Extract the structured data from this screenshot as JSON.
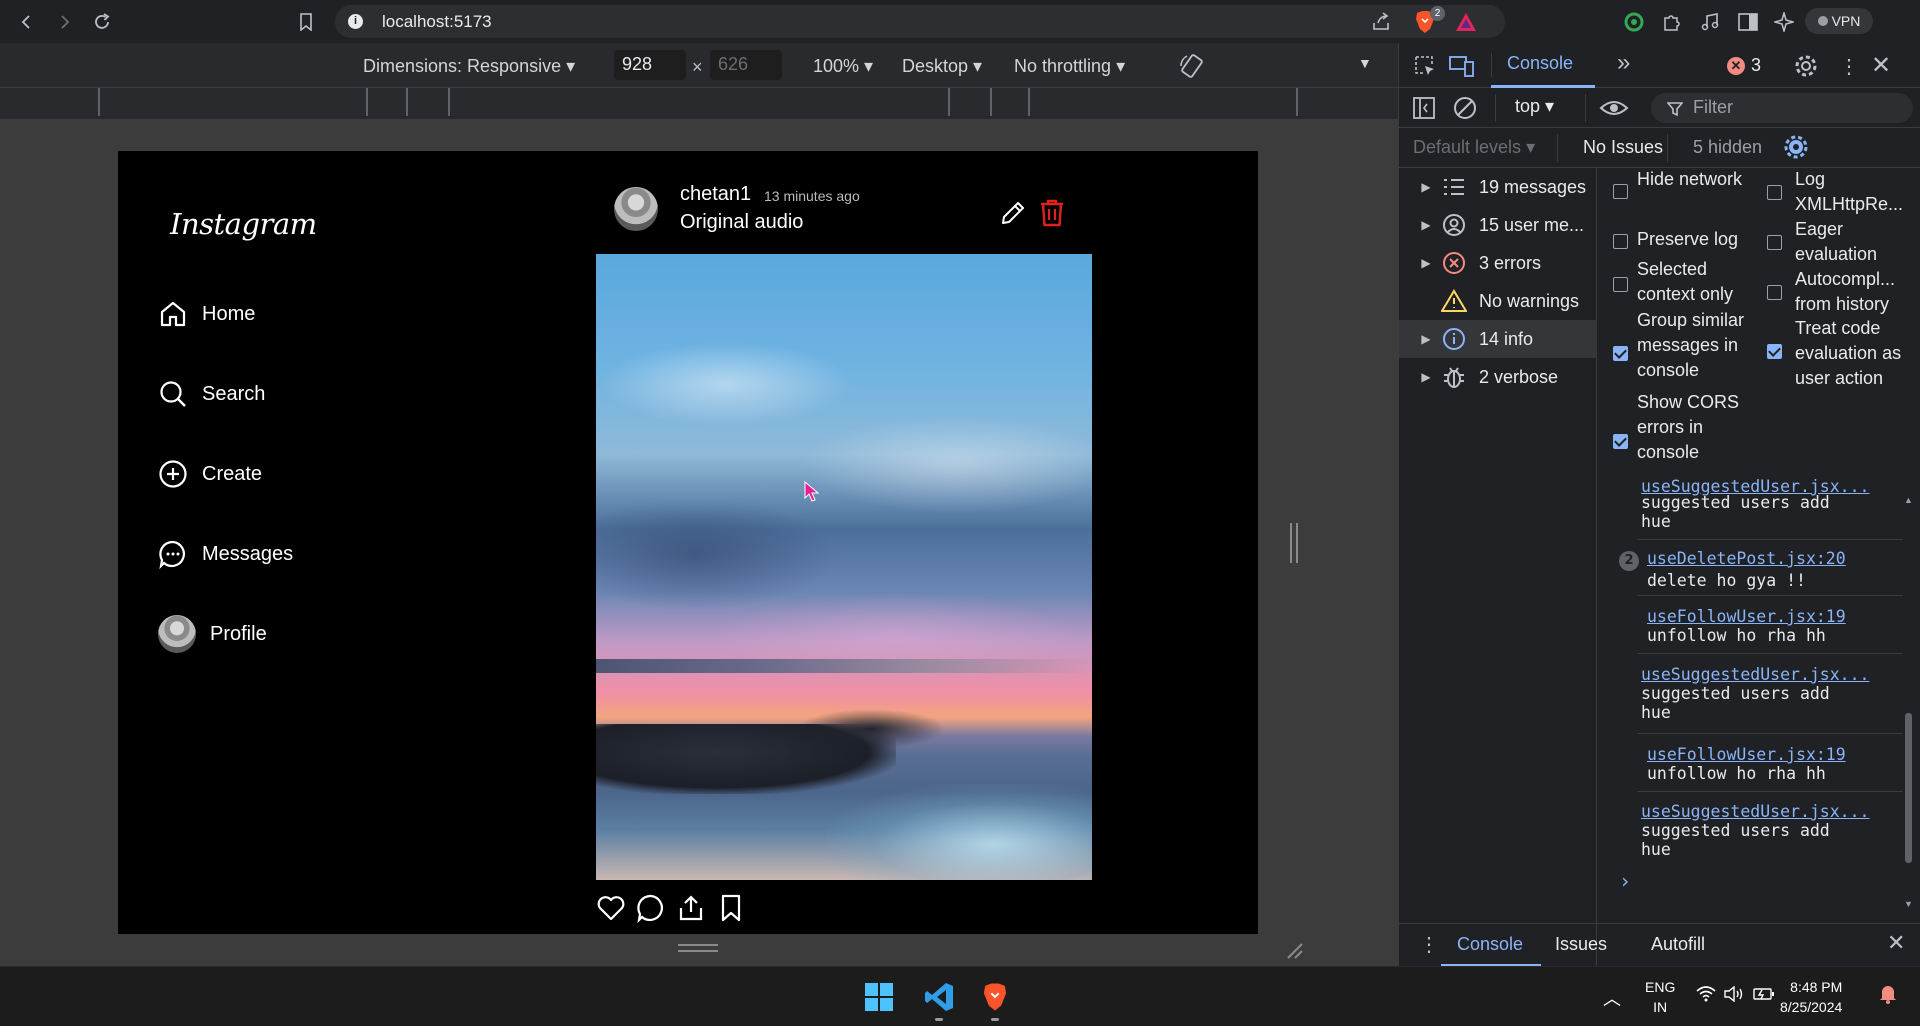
{
  "browser": {
    "url": "localhost:5173",
    "brave_badge_count": "2",
    "vpn_label": "VPN"
  },
  "device_toolbar": {
    "dimensions_label": "Dimensions: Responsive",
    "width_value": "928",
    "times": "×",
    "height_placeholder": "626",
    "zoom_label": "100%",
    "device_type_label": "Desktop",
    "throttling_label": "No throttling"
  },
  "app": {
    "logo": "Instagram",
    "nav": [
      {
        "label": "Home",
        "icon": "home-icon"
      },
      {
        "label": "Search",
        "icon": "search-icon"
      },
      {
        "label": "Create",
        "icon": "plus-circle-icon"
      },
      {
        "label": "Messages",
        "icon": "message-icon"
      },
      {
        "label": "Profile",
        "icon": "avatar"
      }
    ],
    "post": {
      "username": "chetan1",
      "time_ago": "13 minutes ago",
      "audio": "Original audio"
    }
  },
  "devtools": {
    "active_tab": "Console",
    "more_tabs": "»",
    "error_count": "3",
    "context": "top",
    "filter_placeholder": "Filter",
    "levels_label": "Default levels",
    "issues_label": "No Issues",
    "hidden_label": "5 hidden",
    "sidebar": [
      {
        "label": "19 messages",
        "icon": "list-icon",
        "expandable": true
      },
      {
        "label": "15 user me...",
        "icon": "user-icon",
        "expandable": true
      },
      {
        "label": "3 errors",
        "icon": "error-icon",
        "expandable": true
      },
      {
        "label": "No warnings",
        "icon": "warning-icon",
        "expandable": false
      },
      {
        "label": "14 info",
        "icon": "info-icon",
        "expandable": true
      },
      {
        "label": "2 verbose",
        "icon": "bug-icon",
        "expandable": true
      }
    ],
    "settings_left": [
      {
        "label": "Hide network",
        "checked": false
      },
      {
        "label": "Preserve log",
        "checked": false
      },
      {
        "label": "Selected context only",
        "checked": false
      },
      {
        "label": "Group similar messages in console",
        "checked": true
      },
      {
        "label": "Show CORS errors in console",
        "checked": true
      }
    ],
    "settings_right": [
      {
        "label": "Log XMLHttpRe...",
        "checked": false
      },
      {
        "label": "Eager evaluation",
        "checked": false
      },
      {
        "label": "Autocompl... from history",
        "checked": false
      },
      {
        "label": "Treat code evaluation as user action",
        "checked": true
      }
    ],
    "logs": [
      {
        "source": "useSuggestedUser.jsx...",
        "message_line1": "suggested users add",
        "message_line2": "hue"
      },
      {
        "source": "useDeletePost.jsx:20",
        "count": "2",
        "message_line1": "delete ho gya !!"
      },
      {
        "source": "useFollowUser.jsx:19",
        "message_line1": "unfollow ho rha hh"
      },
      {
        "source": "useSuggestedUser.jsx...",
        "message_line1": "suggested users add",
        "message_line2": "hue"
      },
      {
        "source": "useFollowUser.jsx:19",
        "message_line1": "unfollow ho rha hh"
      },
      {
        "source": "useSuggestedUser.jsx...",
        "message_line1": "suggested users add",
        "message_line2": "hue"
      }
    ],
    "prompt": "›",
    "drawer_tabs": [
      "Console",
      "Issues",
      "Autofill"
    ]
  },
  "taskbar": {
    "lang_line1": "ENG",
    "lang_line2": "IN",
    "time": "8:48 PM",
    "date": "8/25/2024"
  },
  "colors": {
    "accent": "#8ab4f8",
    "error": "#f28b82",
    "delete_icon": "#e0211d"
  }
}
